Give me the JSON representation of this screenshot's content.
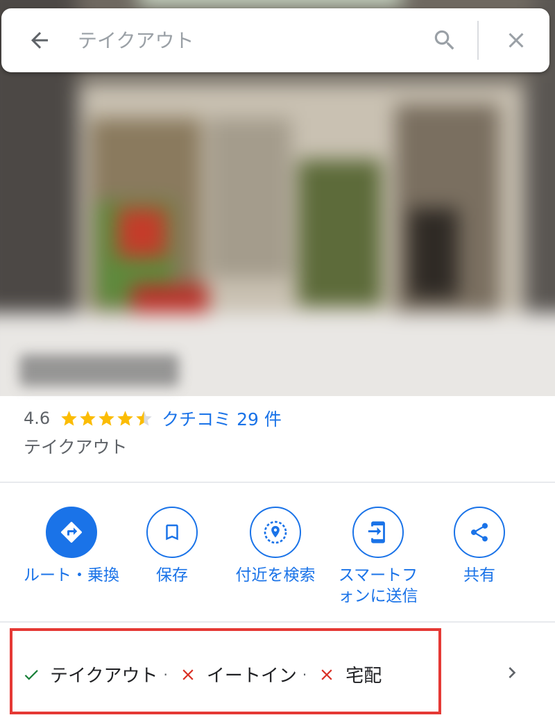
{
  "search": {
    "placeholder": "テイクアウト"
  },
  "place": {
    "rating": "4.6",
    "stars": 4.5,
    "reviews_label": "クチコミ 29 件",
    "category": "テイクアウト"
  },
  "actions": [
    {
      "label": "ルート・乗換",
      "icon": "directions-icon"
    },
    {
      "label": "保存",
      "icon": "bookmark-icon"
    },
    {
      "label": "付近を検索",
      "icon": "nearby-search-icon"
    },
    {
      "label": "スマートフォンに送信",
      "icon": "send-to-phone-icon"
    },
    {
      "label": "共有",
      "icon": "share-icon"
    }
  ],
  "services": {
    "takeout": "テイクアウト",
    "dine_in": "イートイン",
    "delivery": "宅配"
  },
  "colors": {
    "accent": "#1a73e8",
    "star": "#fbbc04",
    "check": "#188038",
    "cross": "#d93025",
    "highlight": "#e53935"
  }
}
